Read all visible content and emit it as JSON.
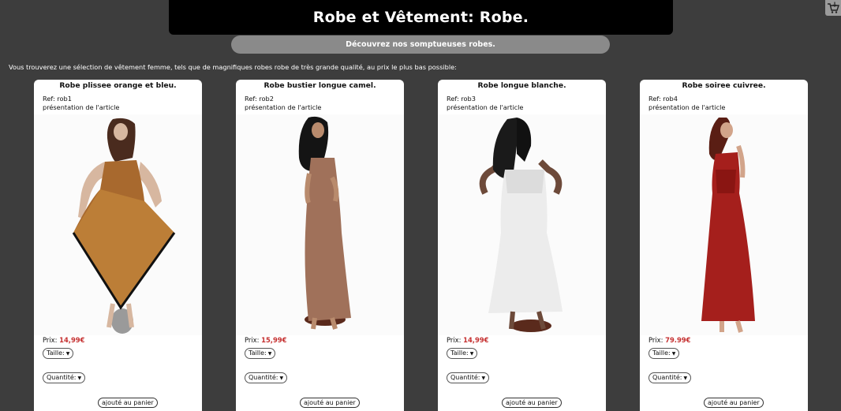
{
  "header": {
    "title": "Robe et Vêtement: Robe."
  },
  "subtitle": "Découvrez nos somptueuses robes.",
  "cart": {
    "icon": "cart-icon"
  },
  "intro": "Vous trouverez une sélection de vêtement femme, tels que de magnifiques robes robe de très grande qualité, au prix le plus bas possible:",
  "colors": {
    "background": "#3d3d3d",
    "price": "#c53030"
  },
  "products": [
    {
      "title": "Robe plissee orange et bleu.",
      "ref": "Ref: rob1",
      "presentation": "présentation de l'article",
      "price_label": "Prix:",
      "price": "14,99€",
      "size_label": "Taille:",
      "qty_label": "Quantité:",
      "button": "ajouté au panier"
    },
    {
      "title": "Robe bustier longue camel.",
      "ref": "Ref: rob2",
      "presentation": "présentation de l'article",
      "price_label": "Prix:",
      "price": "15,99€",
      "size_label": "Taille:",
      "qty_label": "Quantité:",
      "button": "ajouté au panier"
    },
    {
      "title": "Robe longue blanche.",
      "ref": "Ref: rob3",
      "presentation": "présentation de l'article",
      "price_label": "Prix:",
      "price": "14,99€",
      "size_label": "Taille:",
      "qty_label": "Quantité:",
      "button": "ajouté au panier"
    },
    {
      "title": "Robe soiree cuivree.",
      "ref": "Ref: rob4",
      "presentation": "présentation de l'article",
      "price_label": "Prix:",
      "price": "79.99€",
      "size_label": "Taille:",
      "qty_label": "Quantité:",
      "button": "ajouté au panier"
    }
  ]
}
